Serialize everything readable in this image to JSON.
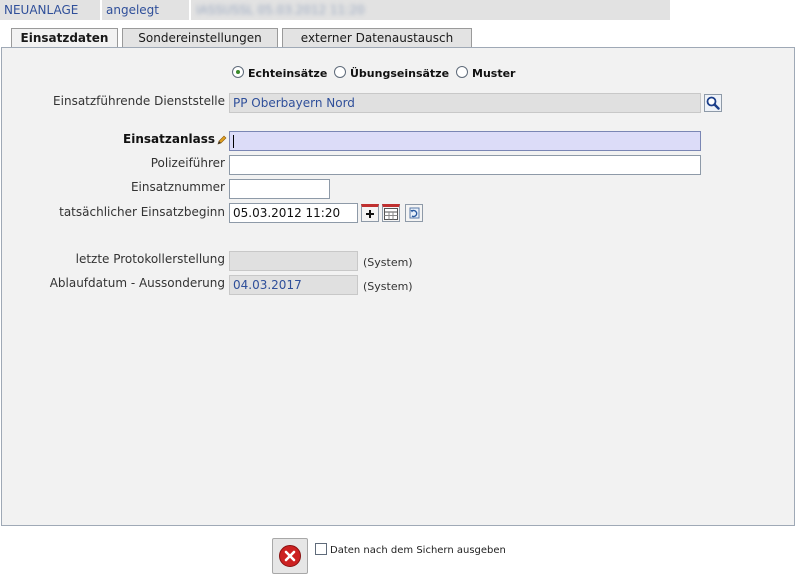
{
  "status": {
    "mode": "NEUANLAGE",
    "state": "angelegt",
    "info": "IASSUSSL 05.03.2012 11:20"
  },
  "tabs": [
    {
      "label": "Einsatzdaten",
      "active": true
    },
    {
      "label": "Sondereinstellungen",
      "active": false
    },
    {
      "label": "externer Datenaustausch",
      "active": false
    }
  ],
  "form": {
    "radio_options": [
      {
        "label": "Echteinsätze",
        "checked": true
      },
      {
        "label": "Übungseinsätze",
        "checked": false
      },
      {
        "label": "Muster",
        "checked": false
      }
    ],
    "dienststelle": {
      "label": "Einsatzführende Dienststelle",
      "value": "PP Oberbayern Nord"
    },
    "einsatzanlass": {
      "label": "Einsatzanlass",
      "value": ""
    },
    "polizeifuehrer": {
      "label": "Polizeiführer",
      "value": ""
    },
    "einsatznummer": {
      "label": "Einsatznummer",
      "value": ""
    },
    "einsatzbeginn": {
      "label": "tatsächlicher Einsatzbeginn",
      "value": "05.03.2012 11:20"
    },
    "protokoll": {
      "label": "letzte Protokollerstellung",
      "value": "",
      "note": "(System)"
    },
    "ablauf": {
      "label": "Ablaufdatum - Aussonderung",
      "value": "04.03.2017",
      "note": "(System)"
    }
  },
  "footer": {
    "checkbox_label": "Daten nach dem Sichern ausgeben",
    "checkbox_checked": false
  },
  "icons": {
    "search": "search-icon",
    "pencil": "pencil-icon",
    "plus": "plus-icon",
    "calendar": "calendar-icon",
    "reset": "reset-calendar-icon",
    "cancel": "cancel-icon"
  },
  "colors": {
    "panel_bg": "#f2f2f2",
    "link_text": "#2f4f9a",
    "focus_field": "#dcdcf8",
    "cancel_red": "#cc2222"
  }
}
